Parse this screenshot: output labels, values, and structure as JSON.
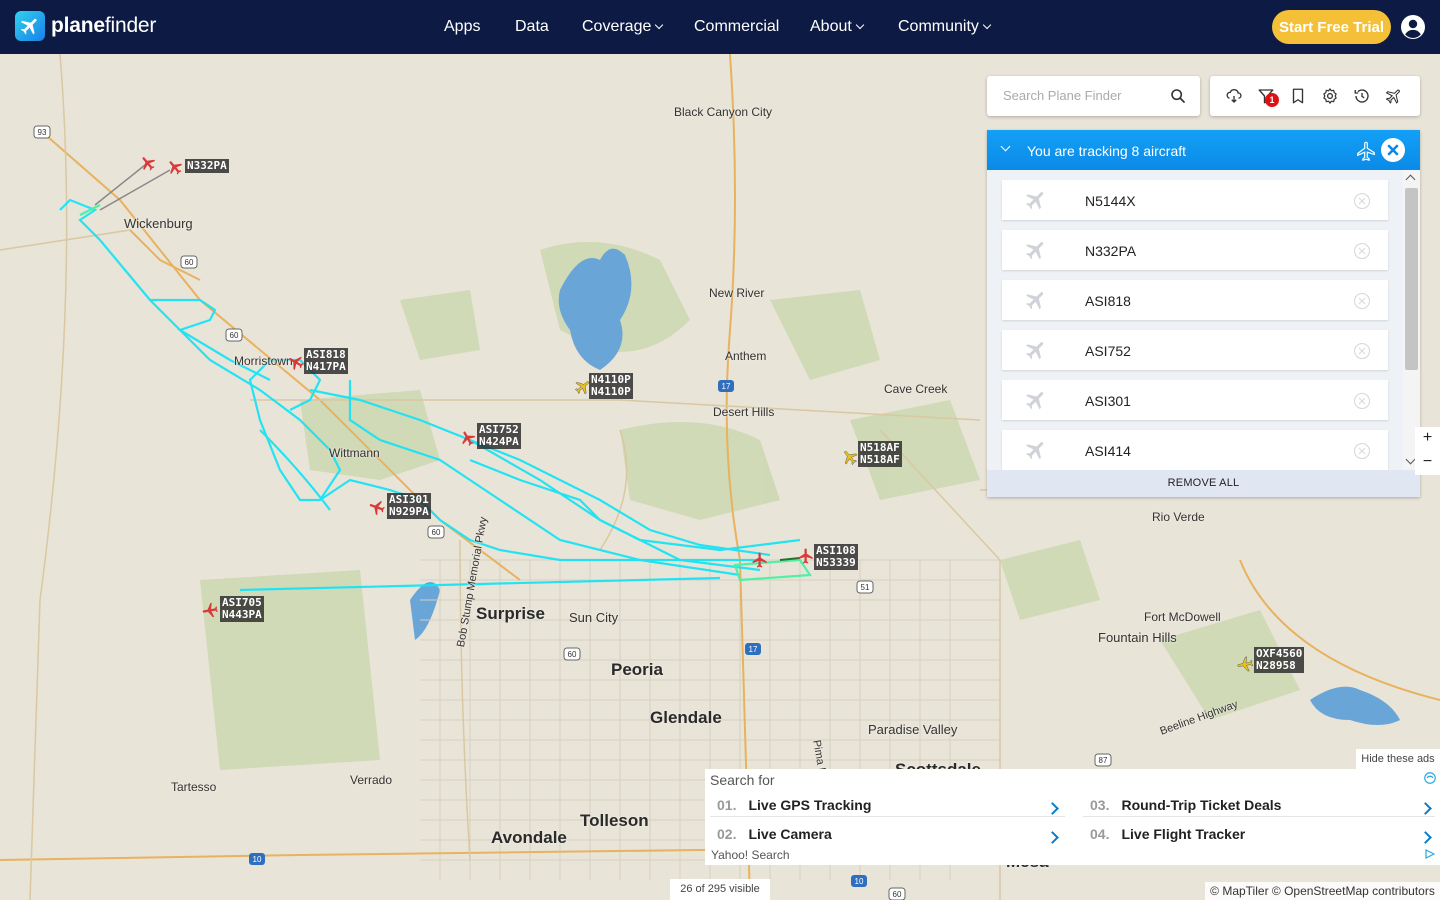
{
  "header": {
    "logo_text_bold": "plane",
    "logo_text_light": "finder",
    "nav": [
      {
        "label": "Apps"
      },
      {
        "label": "Data"
      },
      {
        "label": "Coverage"
      },
      {
        "label": "Commercial"
      },
      {
        "label": "About"
      },
      {
        "label": "Community"
      }
    ],
    "trial_label": "Start Free Trial"
  },
  "search": {
    "placeholder": "Search Plane Finder"
  },
  "tools": {
    "filter_badge": "1",
    "icons": [
      "weather-icon",
      "filter-icon",
      "bookmark-icon",
      "settings-icon",
      "history-icon",
      "ai-icon"
    ]
  },
  "tracking": {
    "title": "You are tracking 8 aircraft",
    "aircraft": [
      {
        "callsign": "N5144X"
      },
      {
        "callsign": "N332PA"
      },
      {
        "callsign": "ASI818"
      },
      {
        "callsign": "ASI752"
      },
      {
        "callsign": "ASI301"
      },
      {
        "callsign": "ASI414"
      }
    ],
    "remove_all": "REMOVE ALL"
  },
  "map": {
    "places": [
      {
        "name": "Black Canyon City"
      },
      {
        "name": "Wickenburg"
      },
      {
        "name": "New River"
      },
      {
        "name": "Anthem"
      },
      {
        "name": "Morristown"
      },
      {
        "name": "Cave Creek"
      },
      {
        "name": "Desert Hills"
      },
      {
        "name": "Wittmann"
      },
      {
        "name": "Rio Verde"
      },
      {
        "name": "Surprise"
      },
      {
        "name": "Sun City"
      },
      {
        "name": "Fort McDowell"
      },
      {
        "name": "Fountain Hills"
      },
      {
        "name": "Peoria"
      },
      {
        "name": "Glendale"
      },
      {
        "name": "Paradise Valley"
      },
      {
        "name": "Tartesso"
      },
      {
        "name": "Verrado"
      },
      {
        "name": "Tolleson"
      },
      {
        "name": "Avondale"
      },
      {
        "name": "Scottsdale"
      },
      {
        "name": "Mesa"
      },
      {
        "name": "Bob Stump Memorial Pkwy"
      },
      {
        "name": "Beeline Highway"
      },
      {
        "name": "Pima Fwy"
      }
    ],
    "aircraft_labels": [
      {
        "callsign": "N332PA",
        "reg": ""
      },
      {
        "callsign": "ASI818",
        "reg": "N417PA"
      },
      {
        "callsign": "N4110P",
        "reg": "N4110P"
      },
      {
        "callsign": "ASI752",
        "reg": "N424PA"
      },
      {
        "callsign": "N518AF",
        "reg": "N518AF"
      },
      {
        "callsign": "ASI301",
        "reg": "N929PA"
      },
      {
        "callsign": "ASI108",
        "reg": "N53339"
      },
      {
        "callsign": "ASI705",
        "reg": "N443PA"
      },
      {
        "callsign": "OXF4560",
        "reg": "N28958"
      }
    ],
    "highway_shields": [
      "93",
      "60",
      "60",
      "17",
      "60",
      "51",
      "60",
      "17",
      "87",
      "10",
      "10",
      "60"
    ]
  },
  "zoom": {
    "plus": "+",
    "minus": "−"
  },
  "ads": {
    "hide_label": "Hide these ads",
    "search_for": "Search for",
    "items": [
      {
        "num": "01.",
        "text": "Live GPS Tracking"
      },
      {
        "num": "02.",
        "text": "Live Camera"
      },
      {
        "num": "03.",
        "text": "Round-Trip Ticket Deals"
      },
      {
        "num": "04.",
        "text": "Live Flight Tracker"
      }
    ],
    "footer": "Yahoo! Search"
  },
  "status": {
    "visible": "26 of 295 visible",
    "attribution": "© MapTiler © OpenStreetMap contributors"
  },
  "colors": {
    "header": "#0c1a44",
    "trial": "#f4c038",
    "track_head": "#0b8ae8",
    "trail": "#19e3f5",
    "tracked_plane": "#d83a3a",
    "other_plane": "#e8c21a"
  }
}
